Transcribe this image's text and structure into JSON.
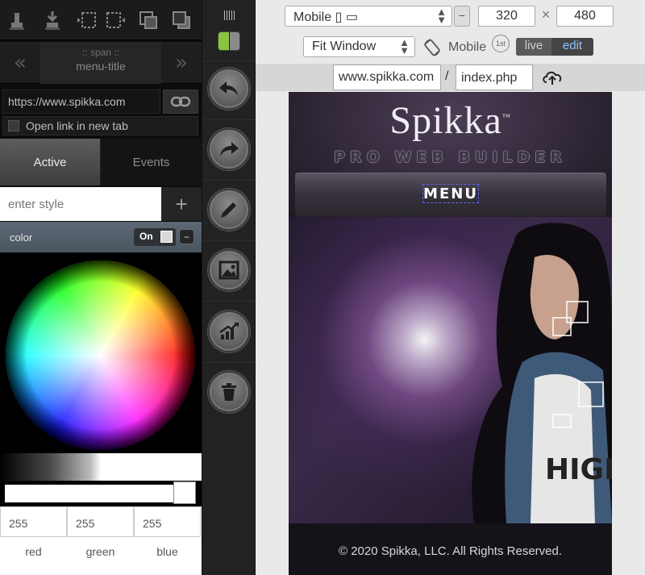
{
  "left": {
    "span_nav": {
      "line1": ":: span ::",
      "line2": "menu-title",
      "prev_label": "«",
      "next_label": "»"
    },
    "link": {
      "url": "https://www.spikka.com",
      "new_tab_label": "Open link in new tab"
    },
    "tabs": {
      "active": "Active",
      "events": "Events"
    },
    "style_input_placeholder": "enter style",
    "add_label": "+",
    "color_row": {
      "label": "color",
      "on_label": "On",
      "minus_label": "−"
    },
    "rgb": {
      "red_value": "255",
      "green_value": "255",
      "blue_value": "255",
      "red_label": "red",
      "green_label": "green",
      "blue_label": "blue"
    }
  },
  "right": {
    "device_select": "Mobile ▯ ▭",
    "device_minus": "−",
    "width": "320",
    "times": "×",
    "height": "480",
    "fit_select": "Fit Window",
    "mobile_label": "Mobile",
    "first_badge": "1st",
    "live_label": "live",
    "edit_label": "edit",
    "domain": "www.spikka.com",
    "slash": "/",
    "file": "index.php"
  },
  "preview": {
    "logo": "Spikka",
    "trademark": "™",
    "tagline": "PRO WEB BUILDER",
    "menu_label": "MENU",
    "footer": "© 2020 Spikka, LLC. All Rights Reserved."
  },
  "colors": {
    "accent_green": "#8bc53f",
    "edit_blue": "#8ac4ff",
    "selection_dash": "#5b6aff"
  }
}
